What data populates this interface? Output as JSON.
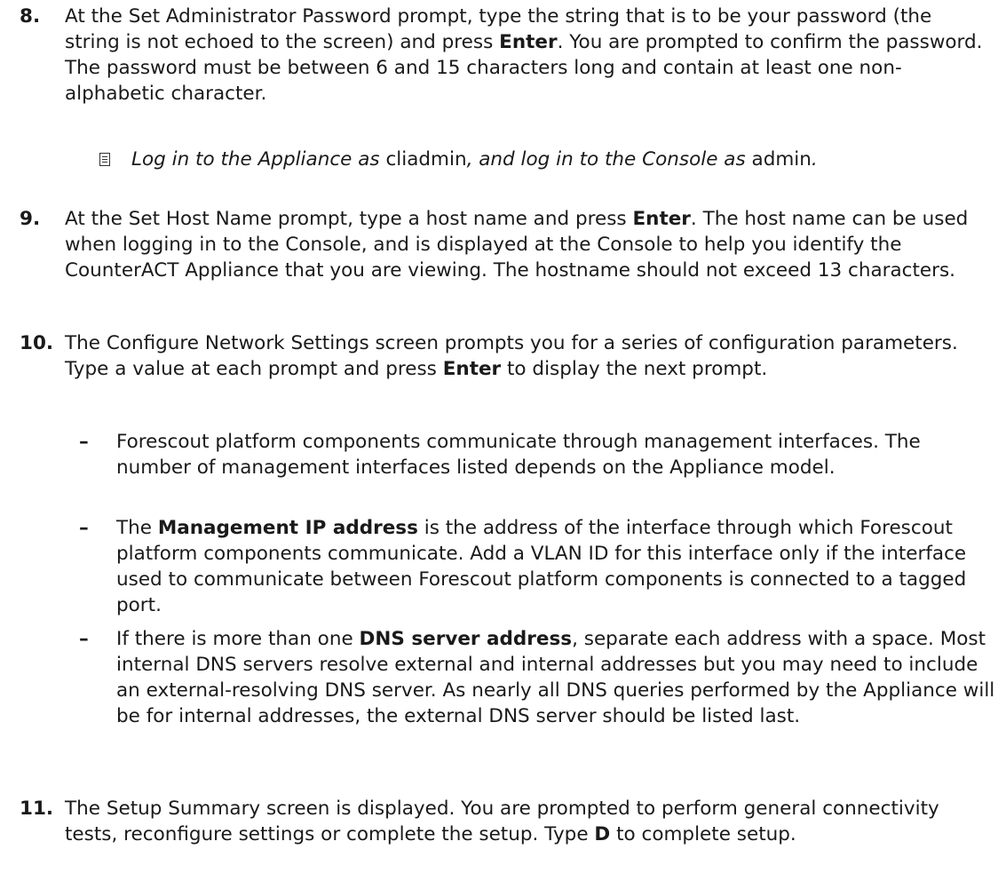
{
  "step8": {
    "number": "8.",
    "t1": "At the Set Administrator Password prompt, type the string that is to be your password (the string is not echoed to the screen) and press ",
    "b1": "Enter",
    "t2": ". You are prompted to confirm the password. The password must be between 6 and 15 characters long and contain at least one non-alphabetic character."
  },
  "note": {
    "icon": "note-icon",
    "t1": "Log in to the Appliance as ",
    "p1": "cliadmin",
    "t2": ", and log in to the Console as ",
    "p2": "admin",
    "t3": "."
  },
  "step9": {
    "number": "9.",
    "t1": "At the Set Host Name prompt, type a host name and press ",
    "b1": "Enter",
    "t2": ". The host name can be used when logging in to the Console, and is displayed at the Console to help you identify the CounterACT Appliance that you are viewing. The hostname should not exceed 13 characters."
  },
  "step10": {
    "number": "10.",
    "t1": "The Configure Network Settings  screen prompts you for a series of configuration parameters. Type a value at each prompt and press ",
    "b1": "Enter",
    "t2": " to display the next prompt."
  },
  "bullets": [
    {
      "dash": "–",
      "t1": "Forescout platform components communicate through management interfaces. The number of management interfaces listed depends on the Appliance model.",
      "b1": "",
      "t2": ""
    },
    {
      "dash": "–",
      "t1": "The ",
      "b1": "Management IP address",
      "t2": " is the address of the interface through which Forescout platform components communicate. Add a VLAN ID for this interface only if the interface used to communicate between Forescout platform components is connected to a tagged port."
    },
    {
      "dash": "–",
      "t1": "If there is more than one ",
      "b1": "DNS server address",
      "t2": ", separate each address with a space. Most internal DNS servers resolve external and internal addresses but you may need to include an external-resolving DNS server. As nearly all DNS queries performed by the Appliance will be for internal addresses, the external DNS server should be listed last."
    }
  ],
  "step11": {
    "number": "11.",
    "t1": "The Setup Summary screen is displayed. You are prompted to perform general connectivity tests, reconfigure settings or complete the setup. Type ",
    "b1": "D",
    "t2": " to complete setup."
  }
}
